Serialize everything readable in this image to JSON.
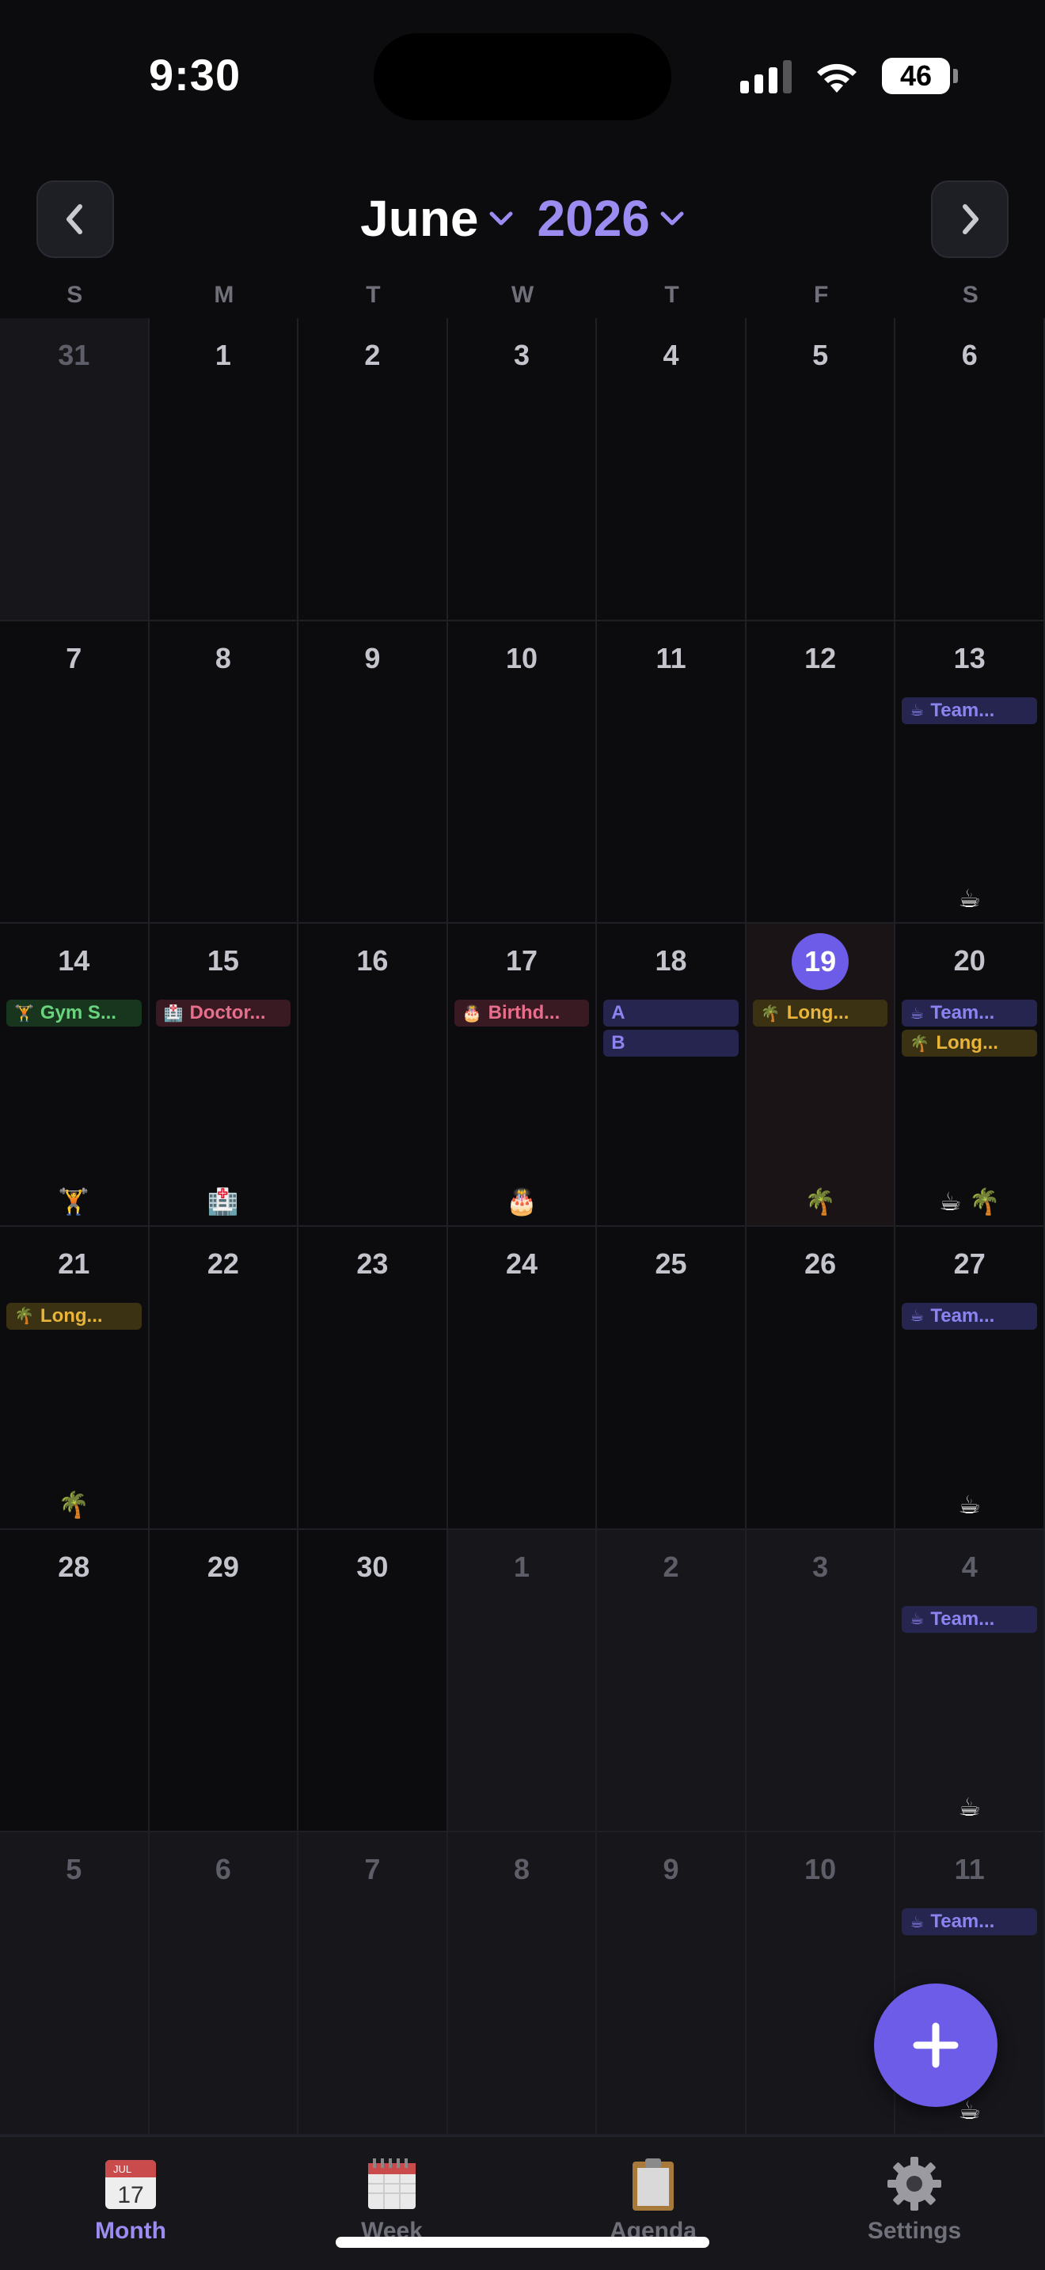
{
  "status_bar": {
    "time": "9:30",
    "battery": "46"
  },
  "header": {
    "month": "June",
    "year": "2026"
  },
  "weekdays": [
    "S",
    "M",
    "T",
    "W",
    "T",
    "F",
    "S"
  ],
  "weeks": [
    [
      {
        "day": "31",
        "out": true,
        "events": [],
        "emojis": ""
      },
      {
        "day": "1",
        "events": [],
        "emojis": ""
      },
      {
        "day": "2",
        "events": [],
        "emojis": ""
      },
      {
        "day": "3",
        "events": [],
        "emojis": ""
      },
      {
        "day": "4",
        "events": [],
        "emojis": ""
      },
      {
        "day": "5",
        "events": [],
        "emojis": ""
      },
      {
        "day": "6",
        "events": [],
        "emojis": ""
      }
    ],
    [
      {
        "day": "7",
        "events": [],
        "emojis": ""
      },
      {
        "day": "8",
        "events": [],
        "emojis": ""
      },
      {
        "day": "9",
        "events": [],
        "emojis": ""
      },
      {
        "day": "10",
        "events": [],
        "emojis": ""
      },
      {
        "day": "11",
        "events": [],
        "emojis": ""
      },
      {
        "day": "12",
        "events": [],
        "emojis": ""
      },
      {
        "day": "13",
        "events": [
          {
            "icon": "☕",
            "label": "Team...",
            "kind": "team"
          }
        ],
        "emojis": "☕"
      }
    ],
    [
      {
        "day": "14",
        "events": [
          {
            "icon": "🏋",
            "label": "Gym S...",
            "kind": "gym"
          }
        ],
        "emojis": "🏋"
      },
      {
        "day": "15",
        "events": [
          {
            "icon": "🏥",
            "label": "Doctor...",
            "kind": "doctor"
          }
        ],
        "emojis": "🏥"
      },
      {
        "day": "16",
        "events": [],
        "emojis": ""
      },
      {
        "day": "17",
        "events": [
          {
            "icon": "🎂",
            "label": "Birthd...",
            "kind": "bday"
          }
        ],
        "emojis": "🎂"
      },
      {
        "day": "18",
        "events": [
          {
            "icon": "",
            "label": "A",
            "kind": "ab"
          },
          {
            "icon": "",
            "label": "B",
            "kind": "ab"
          }
        ],
        "emojis": ""
      },
      {
        "day": "19",
        "today": true,
        "events": [
          {
            "icon": "🌴",
            "label": "Long...",
            "kind": "long"
          }
        ],
        "emojis": "🌴"
      },
      {
        "day": "20",
        "events": [
          {
            "icon": "☕",
            "label": "Team...",
            "kind": "team"
          },
          {
            "icon": "🌴",
            "label": "Long...",
            "kind": "long"
          }
        ],
        "emojis": "☕ 🌴"
      }
    ],
    [
      {
        "day": "21",
        "events": [
          {
            "icon": "🌴",
            "label": "Long...",
            "kind": "long"
          }
        ],
        "emojis": "🌴"
      },
      {
        "day": "22",
        "events": [],
        "emojis": ""
      },
      {
        "day": "23",
        "events": [],
        "emojis": ""
      },
      {
        "day": "24",
        "events": [],
        "emojis": ""
      },
      {
        "day": "25",
        "events": [],
        "emojis": ""
      },
      {
        "day": "26",
        "events": [],
        "emojis": ""
      },
      {
        "day": "27",
        "events": [
          {
            "icon": "☕",
            "label": "Team...",
            "kind": "team"
          }
        ],
        "emojis": "☕"
      }
    ],
    [
      {
        "day": "28",
        "events": [],
        "emojis": ""
      },
      {
        "day": "29",
        "events": [],
        "emojis": ""
      },
      {
        "day": "30",
        "events": [],
        "emojis": ""
      },
      {
        "day": "1",
        "out": true,
        "events": [],
        "emojis": ""
      },
      {
        "day": "2",
        "out": true,
        "events": [],
        "emojis": ""
      },
      {
        "day": "3",
        "out": true,
        "events": [],
        "emojis": ""
      },
      {
        "day": "4",
        "out": true,
        "events": [
          {
            "icon": "☕",
            "label": "Team...",
            "kind": "team"
          }
        ],
        "emojis": "☕"
      }
    ],
    [
      {
        "day": "5",
        "out": true,
        "events": [],
        "emojis": ""
      },
      {
        "day": "6",
        "out": true,
        "events": [],
        "emojis": ""
      },
      {
        "day": "7",
        "out": true,
        "events": [],
        "emojis": ""
      },
      {
        "day": "8",
        "out": true,
        "events": [],
        "emojis": ""
      },
      {
        "day": "9",
        "out": true,
        "events": [],
        "emojis": ""
      },
      {
        "day": "10",
        "out": true,
        "events": [],
        "emojis": ""
      },
      {
        "day": "11",
        "out": true,
        "events": [
          {
            "icon": "☕",
            "label": "Team...",
            "kind": "team"
          }
        ],
        "emojis": "☕"
      }
    ]
  ],
  "tabs": [
    {
      "label": "Month",
      "icon": "calendar-month-icon",
      "active": true,
      "icon_text": "17",
      "icon_sub": "JUL"
    },
    {
      "label": "Week",
      "icon": "spiral-calendar-icon",
      "active": false
    },
    {
      "label": "Agenda",
      "icon": "clipboard-icon",
      "active": false
    },
    {
      "label": "Settings",
      "icon": "gear-icon",
      "active": false
    }
  ],
  "colors": {
    "accent": "#6c5ce7",
    "accent_light": "#9b8cf2",
    "background": "#0c0c0e",
    "team": "#8b84f0",
    "long": "#e9b43a",
    "gym": "#6ad37e",
    "doctor": "#e76f8b"
  }
}
